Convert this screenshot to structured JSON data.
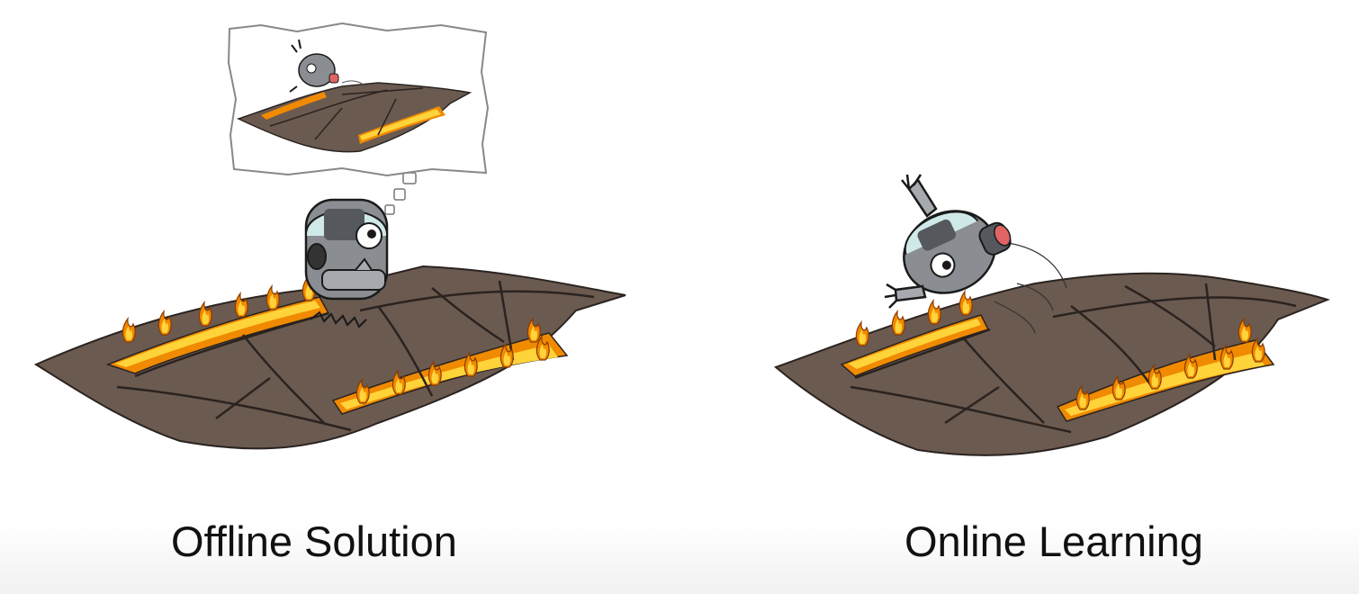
{
  "captions": {
    "offline": "Offline Solution",
    "online": "Online Learning"
  },
  "colors": {
    "ground": "#6b5a50",
    "ground_dark": "#5a4a42",
    "grid_line": "#2a2320",
    "fire_outer": "#f08a00",
    "fire_inner": "#ffd33a",
    "robot_body": "#8a8d91",
    "robot_dark": "#55585c",
    "visor": "#cfe9e8",
    "mouth": "#e06464"
  },
  "icons": {
    "offline_robot": "thinking-robot-icon",
    "online_robot": "falling-robot-icon",
    "thought_bubble": "thought-bubble-icon"
  }
}
